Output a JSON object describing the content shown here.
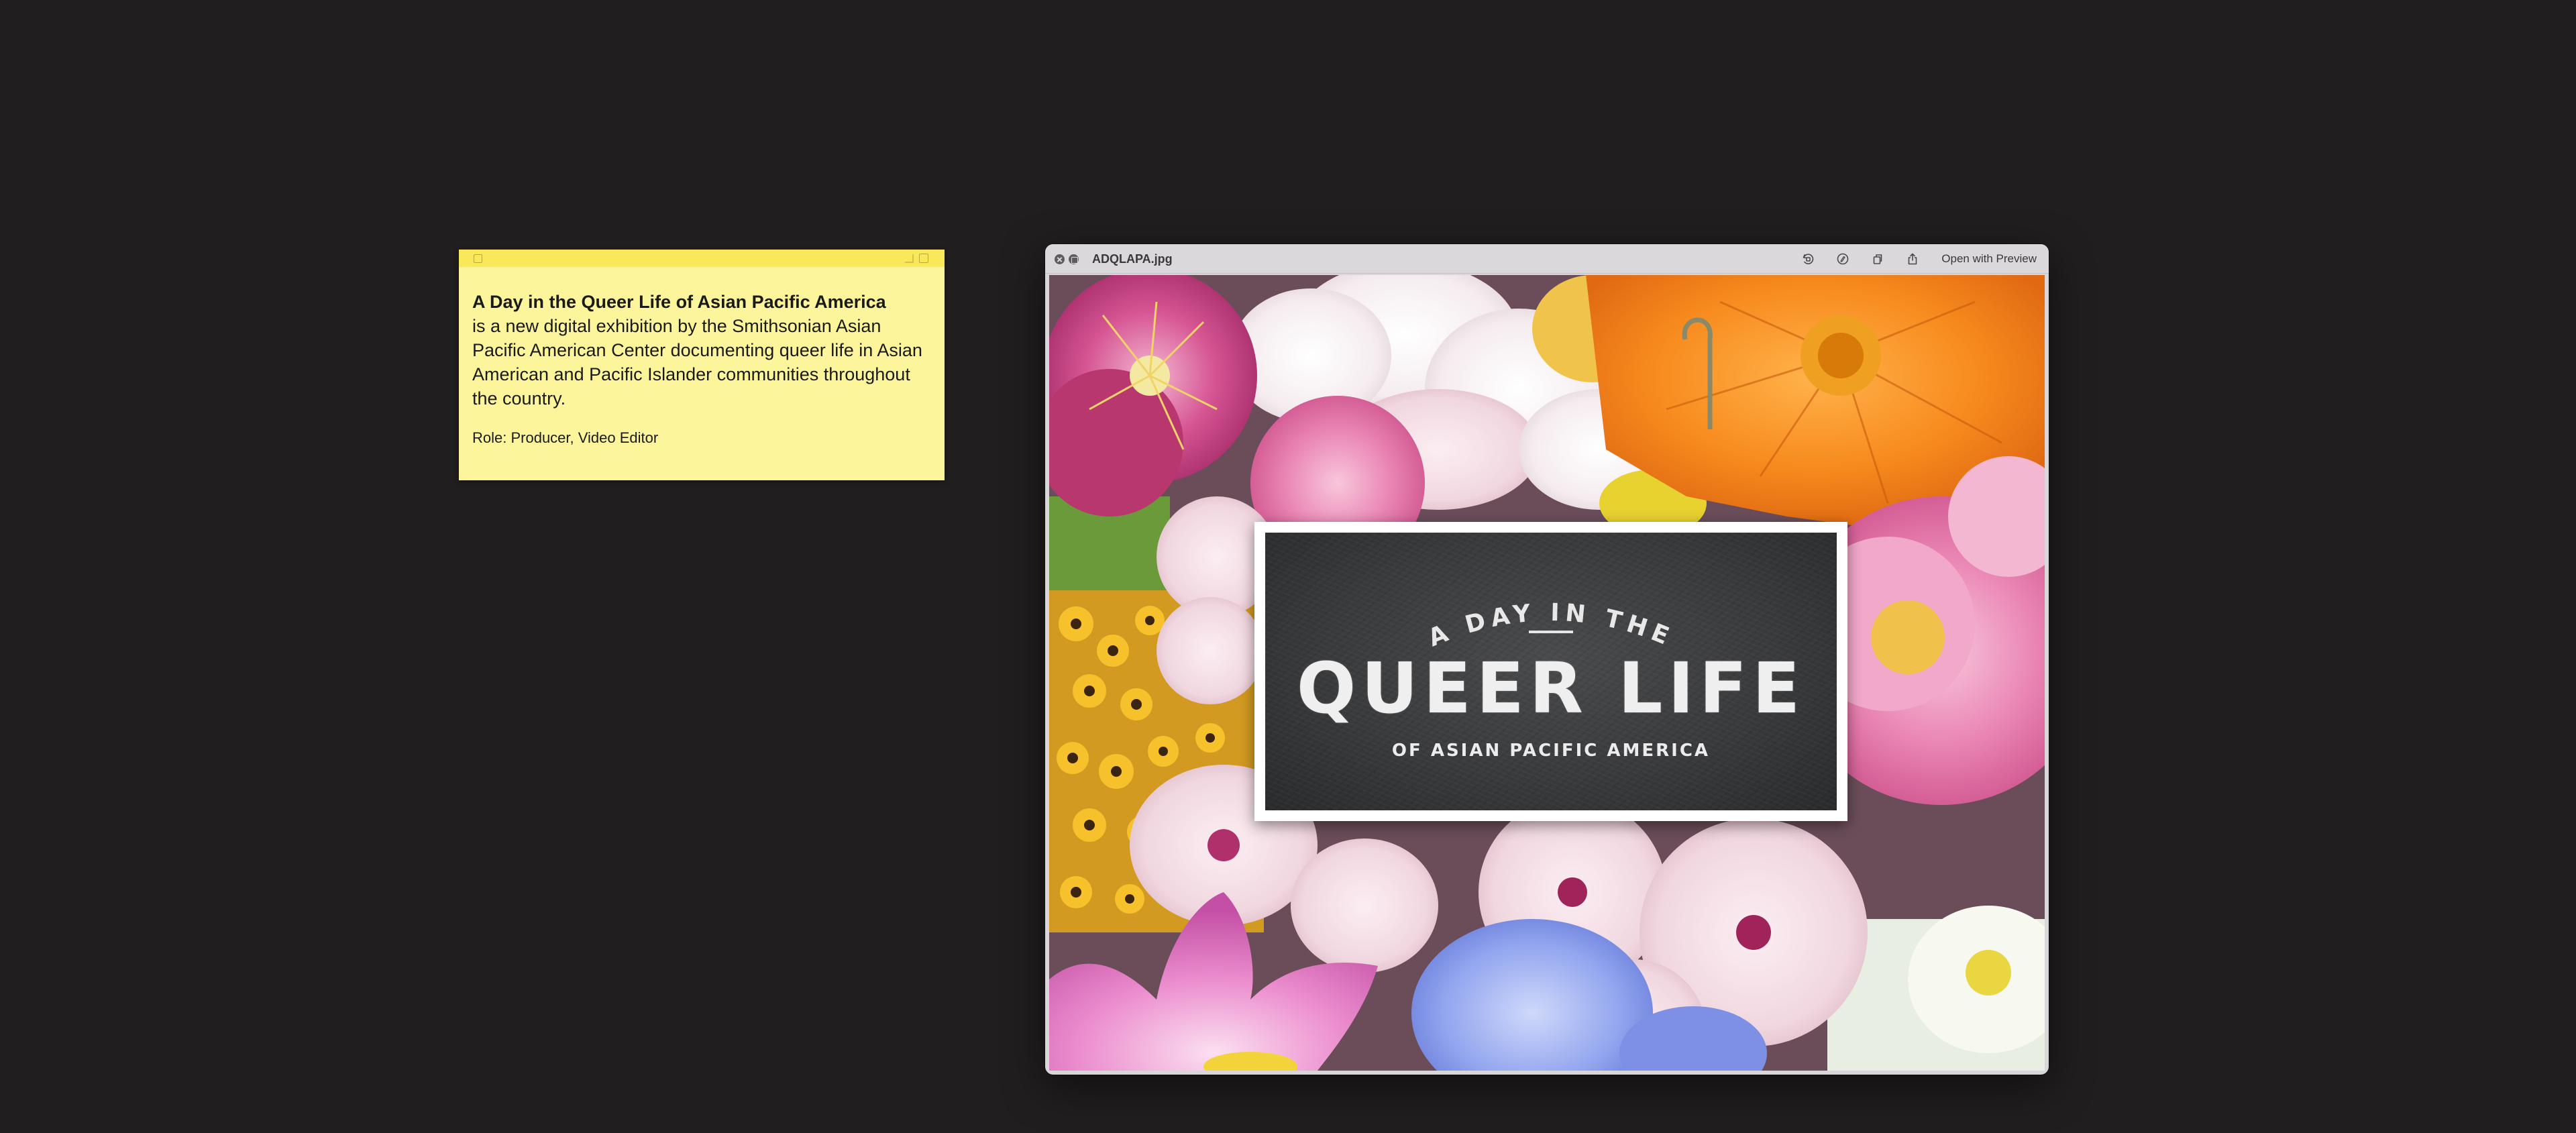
{
  "sticky_note": {
    "title": "A Day in the Queer Life of Asian Pacific America",
    "body": "is a new digital exhibition by the Smithsonian Asian Pacific American Center documenting queer life in Asian American and Pacific Islander communities throughout the country.",
    "role": "Role: Producer, Video Editor",
    "colors": {
      "body": "#fdf59c",
      "titlebar": "#f8e85a"
    }
  },
  "quicklook": {
    "filename": "ADQLAPA.jpg",
    "open_button": "Open with Preview",
    "tools": [
      "rotate-icon",
      "markup-icon",
      "share-copy-icon",
      "share-icon"
    ]
  },
  "artwork": {
    "arc_text": "A DAY IN THE",
    "main_text": "QUEER LIFE",
    "sub_text": "OF ASIAN PACIFIC AMERICA"
  }
}
